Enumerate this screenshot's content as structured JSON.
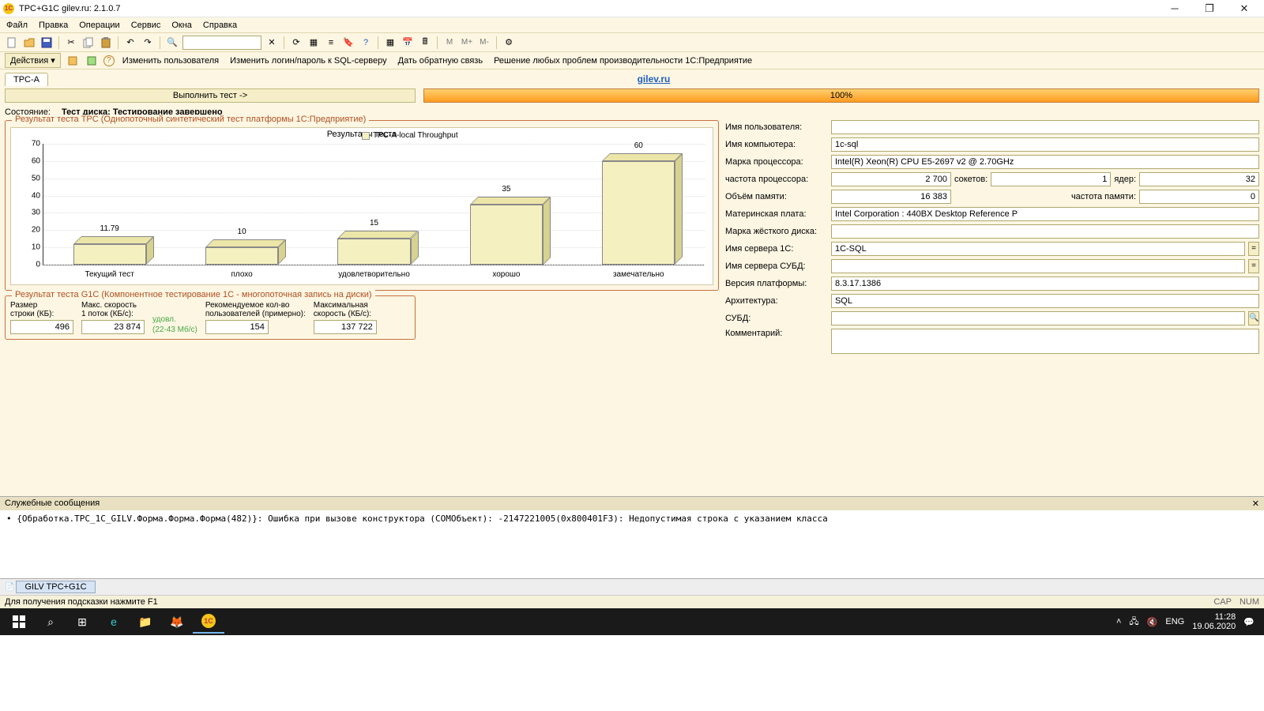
{
  "window": {
    "title": "TPC+G1C gilev.ru: 2.1.0.7"
  },
  "menubar": [
    "Файл",
    "Правка",
    "Операции",
    "Сервис",
    "Окна",
    "Справка"
  ],
  "toolbar2": {
    "actions": "Действия ▾",
    "links": [
      "Изменить пользователя",
      "Изменить логин/пароль к SQL-серверу",
      "Дать обратную связь",
      "Решение любых проблем производительности 1С:Предприятие"
    ]
  },
  "tab": "TPC-A",
  "gilev_link": "gilev.ru",
  "run_button": "Выполнить тест ->",
  "progress": "100%",
  "status": {
    "label": "Состояние:",
    "value": "Тест диска: Тестирование завершено"
  },
  "tpc_group": "Результат теста TPC (Однопоточный синтетический тест платформы 1С:Предприятие)",
  "chart_data": {
    "type": "bar",
    "title": "Результаты теста",
    "legend": "TPC-A-local Throughput",
    "categories": [
      "Текущий тест",
      "плохо",
      "удовлетворительно",
      "хорошо",
      "замечательно"
    ],
    "values": [
      11.79,
      10,
      15,
      35,
      60
    ],
    "ylim": [
      0,
      70
    ],
    "yticks": [
      0,
      10,
      20,
      30,
      40,
      50,
      60,
      70
    ]
  },
  "g1c_group": "Результат теста G1C (Компонентное тестирование 1С - многопоточная запись на диски)",
  "g1c": {
    "row_size_lbl": "Размер\nстроки (КБ):",
    "row_size": "496",
    "max_speed_lbl": "Макс. скорость\n1 поток (КБ/с):",
    "max_speed": "23 874",
    "rating1": "удовл.",
    "rating2": "(22-43 Мб/с)",
    "rec_users_lbl": "Рекомендуемое кол-во\nпользователей (примерно):",
    "rec_users": "154",
    "max_total_lbl": "Максимальная\nскорость (КБ/с):",
    "max_total": "137 722"
  },
  "fields": {
    "user_lbl": "Имя пользователя:",
    "user": "",
    "host_lbl": "Имя компьютера:",
    "host": "1c-sql",
    "cpu_brand_lbl": "Марка процессора:",
    "cpu_brand": "Intel(R) Xeon(R) CPU E5-2697 v2 @ 2.70GHz",
    "cpu_freq_lbl": "частота процессора:",
    "cpu_freq": "2 700",
    "sockets_lbl": "сокетов:",
    "sockets": "1",
    "cores_lbl": "ядер:",
    "cores": "32",
    "ram_lbl": "Объём памяти:",
    "ram": "16 383",
    "ram_freq_lbl": "частота памяти:",
    "ram_freq": "0",
    "mb_lbl": "Материнская плата:",
    "mb": "Intel Corporation : 440BX Desktop Reference P",
    "hdd_lbl": "Марка жёсткого диска:",
    "hdd": "",
    "srv1c_lbl": "Имя сервера 1С:",
    "srv1c": "1C-SQL",
    "srvdb_lbl": "Имя сервера СУБД:",
    "srvdb": "",
    "platver_lbl": "Версия платформы:",
    "platver": "8.3.17.1386",
    "arch_lbl": "Архитектура:",
    "arch": "SQL",
    "dbms_lbl": "СУБД:",
    "dbms": "",
    "comment_lbl": "Комментарий:",
    "comment": ""
  },
  "service": {
    "title": "Служебные сообщения",
    "msg": "{Обработка.TPC_1C_GILV.Форма.Форма.Форма(482)}: Ошибка при вызове конструктора (COMОбъект): -2147221005(0x800401F3): Недопустимая строка с указанием класса"
  },
  "bottom_tab": "GILV TPC+G1C",
  "status_hint": "Для получения подсказки нажмите F1",
  "status_caps": "CAP",
  "status_num": "NUM",
  "tray": {
    "lang": "ENG",
    "time": "11:28",
    "date": "19.06.2020"
  }
}
